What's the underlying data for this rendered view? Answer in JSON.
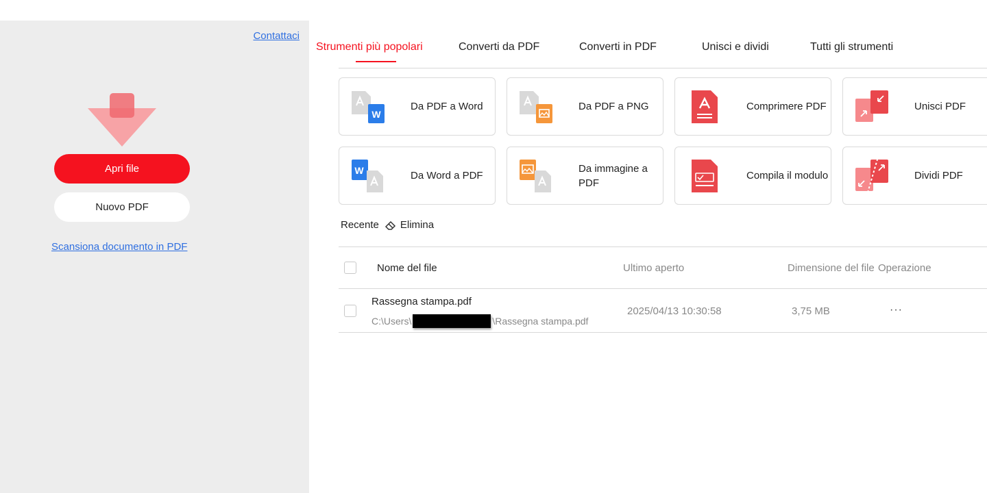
{
  "sidebar": {
    "contact_label": "Contattaci",
    "open_file_label": "Apri file",
    "new_pdf_label": "Nuovo PDF",
    "scan_label": "Scansiona documento in PDF",
    "accent_color": "#f5121f"
  },
  "tabs": [
    {
      "label": "Strumenti più popolari",
      "active": true
    },
    {
      "label": "Converti da PDF",
      "active": false
    },
    {
      "label": "Converti in PDF",
      "active": false
    },
    {
      "label": "Unisci e dividi",
      "active": false
    },
    {
      "label": "Tutti gli strumenti",
      "active": false
    }
  ],
  "tools": [
    {
      "label": "Da PDF a Word",
      "icon": "pdf-to-word-icon"
    },
    {
      "label": "Da PDF a PNG",
      "icon": "pdf-to-png-icon"
    },
    {
      "label": "Comprimere PDF",
      "icon": "compress-pdf-icon"
    },
    {
      "label": "Unisci PDF",
      "icon": "merge-pdf-icon"
    },
    {
      "label": "Da Word a PDF",
      "icon": "word-to-pdf-icon"
    },
    {
      "label": "Da immagine a PDF",
      "icon": "image-to-pdf-icon"
    },
    {
      "label": "Compila il modulo",
      "icon": "fill-form-icon"
    },
    {
      "label": "Dividi PDF",
      "icon": "split-pdf-icon"
    }
  ],
  "recent": {
    "label": "Recente",
    "delete_label": "Elimina",
    "columns": {
      "name": "Nome del file",
      "opened": "Ultimo aperto",
      "size": "Dimensione del file",
      "operation": "Operazione"
    },
    "files": [
      {
        "name": "Rassegna stampa.pdf",
        "path_prefix": "C:\\Users\\",
        "path_suffix": "\\Rassegna stampa.pdf",
        "opened": "2025/04/13 10:30:58",
        "size": "3,75 MB",
        "more": "···"
      }
    ]
  }
}
